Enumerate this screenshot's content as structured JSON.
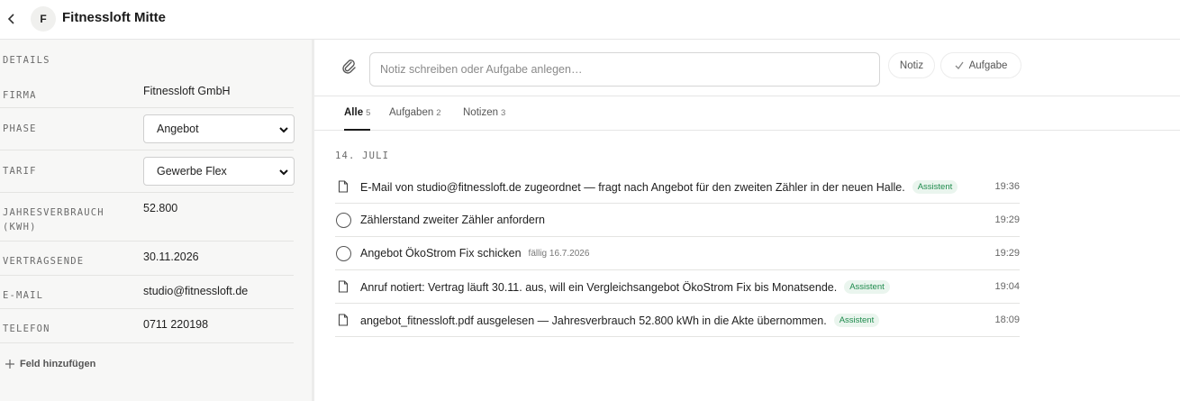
{
  "header": {
    "title": "Fitnessloft Mitte",
    "avatar_letter": "F",
    "back_icon": "chevron-left-icon"
  },
  "details": {
    "heading": "DETAILS",
    "fields": [
      {
        "label": "FIRMA",
        "value": "Fitnessloft GmbH"
      },
      {
        "label": "PHASE",
        "value": "Angebot"
      },
      {
        "label": "TARIF",
        "value": "Gewerbe Flex"
      },
      {
        "label": "JAHRESVERBRAUCH",
        "label2": "(KWH)",
        "value": "52.800"
      },
      {
        "label": "VERTRAGSENDE",
        "value": "30.11.2026"
      },
      {
        "label": "E-MAIL",
        "value": "studio@fitnessloft.de"
      },
      {
        "label": "TELEFON",
        "value": "0711 220198"
      }
    ],
    "add_field": "Feld hinzufügen"
  },
  "composer": {
    "placeholder": "Notiz schreiben oder Aufgabe anlegen…",
    "note_button": "Notiz",
    "task_button": "Aufgabe"
  },
  "tabs": [
    {
      "label": "Alle",
      "count": "5"
    },
    {
      "label": "Aufgaben",
      "count": "2"
    },
    {
      "label": "Notizen",
      "count": "3"
    }
  ],
  "timeline": {
    "date": "14. JULI",
    "items": [
      {
        "type": "note",
        "text": "E-Mail von studio@fitnessloft.de zugeordnet — fragt nach Angebot für den zweiten Zähler in der neuen Halle.",
        "badge": "Assistent",
        "time": "19:36"
      },
      {
        "type": "task",
        "text": "Zählerstand zweiter Zähler anfordern",
        "time": "19:29"
      },
      {
        "type": "task",
        "text": "Angebot ÖkoStrom Fix schicken",
        "due": "fällig 16.7.2026",
        "time": "19:29"
      },
      {
        "type": "note",
        "text": "Anruf notiert: Vertrag läuft 30.11. aus, will ein Vergleichsangebot ÖkoStrom Fix bis Monatsende.",
        "badge": "Assistent",
        "time": "19:04"
      },
      {
        "type": "note",
        "text": "angebot_fitnessloft.pdf ausgelesen — Jahresverbrauch 52.800 kWh in die Akte übernommen.",
        "badge": "Assistent",
        "time": "18:09"
      }
    ]
  }
}
